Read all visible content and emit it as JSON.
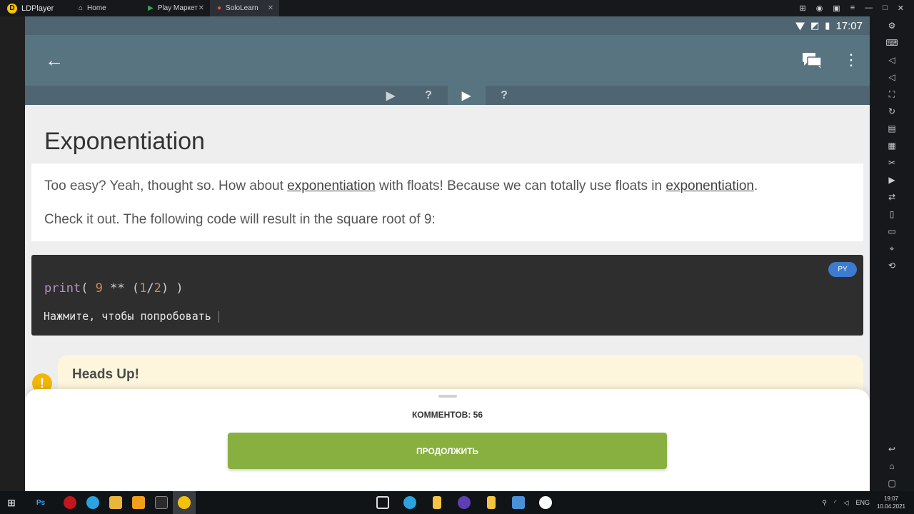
{
  "emulator": {
    "brand": "LDPlayer",
    "tabs": [
      {
        "label": "Home"
      },
      {
        "label": "Play Маркет"
      },
      {
        "label": "SoloLearn"
      }
    ]
  },
  "status": {
    "time": "17:07"
  },
  "lesson": {
    "title": "Exponentiation",
    "paragraph1_part1": "Too easy? Yeah, thought so. How about ",
    "link1": "exponentiation",
    "paragraph1_part2": " with floats! Because we can totally use floats in ",
    "link2": "exponentiation",
    "paragraph1_part3": ".",
    "paragraph2": "Check it out. The following code will result in the square root of 9:",
    "code": {
      "lang_badge": "PY",
      "fn": "print",
      "open": "( ",
      "num1": "9",
      "op": " ** (",
      "num2": "1",
      "slash": "/",
      "num3": "2",
      "close": ") )",
      "try_label": "Нажмите, чтобы попробовать"
    },
    "headsup_title": "Heads Up!",
    "lesson_tabs": [
      "▶",
      "?",
      "▶",
      "?"
    ]
  },
  "sheet": {
    "comments": "КОММЕНТОВ: 56",
    "continue_label": "ПРОДОЛЖИТЬ"
  },
  "taskbar": {
    "lang": "ENG",
    "time": "19:07",
    "date": "10.04.2021"
  },
  "colors": {
    "appbar": "#587480",
    "continue": "#88b040",
    "code_bg": "#2e2e2e"
  }
}
